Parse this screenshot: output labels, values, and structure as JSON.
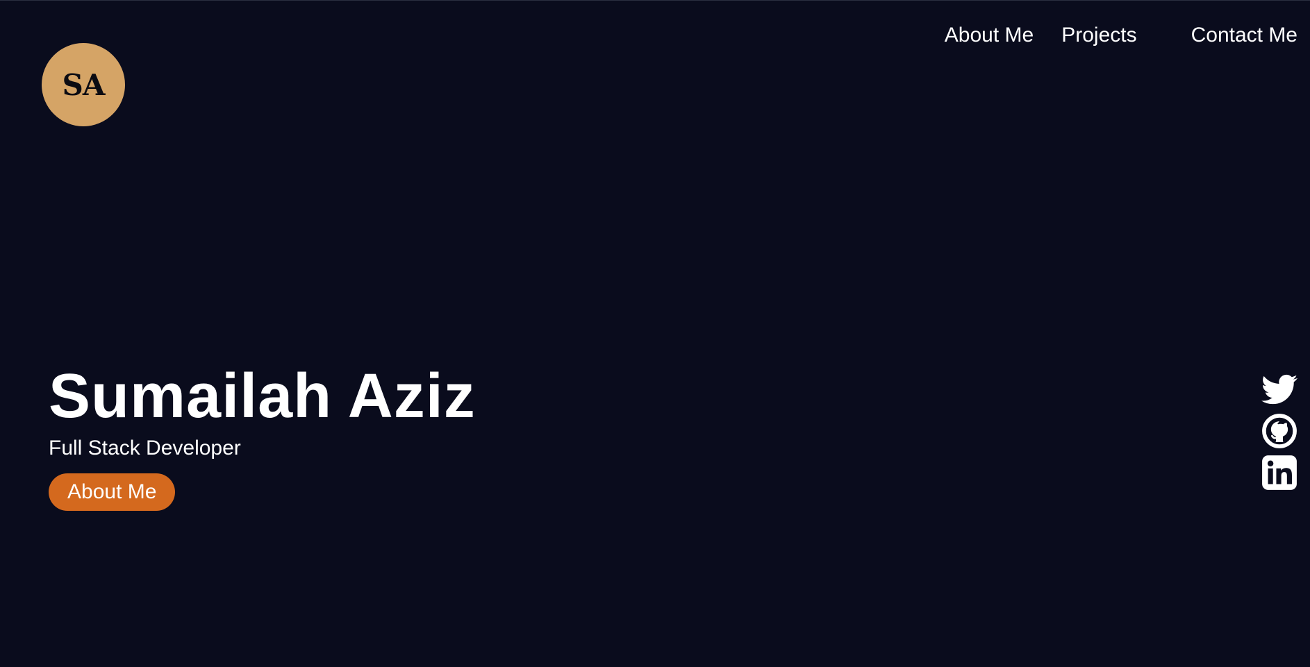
{
  "logo": {
    "text": "SA",
    "color": "#d5a466"
  },
  "nav": {
    "items": [
      {
        "label": "About Me"
      },
      {
        "label": "Projects"
      },
      {
        "label": "Contact Me"
      }
    ]
  },
  "hero": {
    "name": "Sumailah Aziz",
    "role": "Full Stack Developer",
    "button_label": "About Me",
    "button_color": "#d4691e"
  },
  "social": {
    "icons": [
      "twitter-icon",
      "github-icon",
      "linkedin-icon"
    ]
  },
  "colors": {
    "background": "#0a0c1d",
    "text": "#ffffff"
  }
}
